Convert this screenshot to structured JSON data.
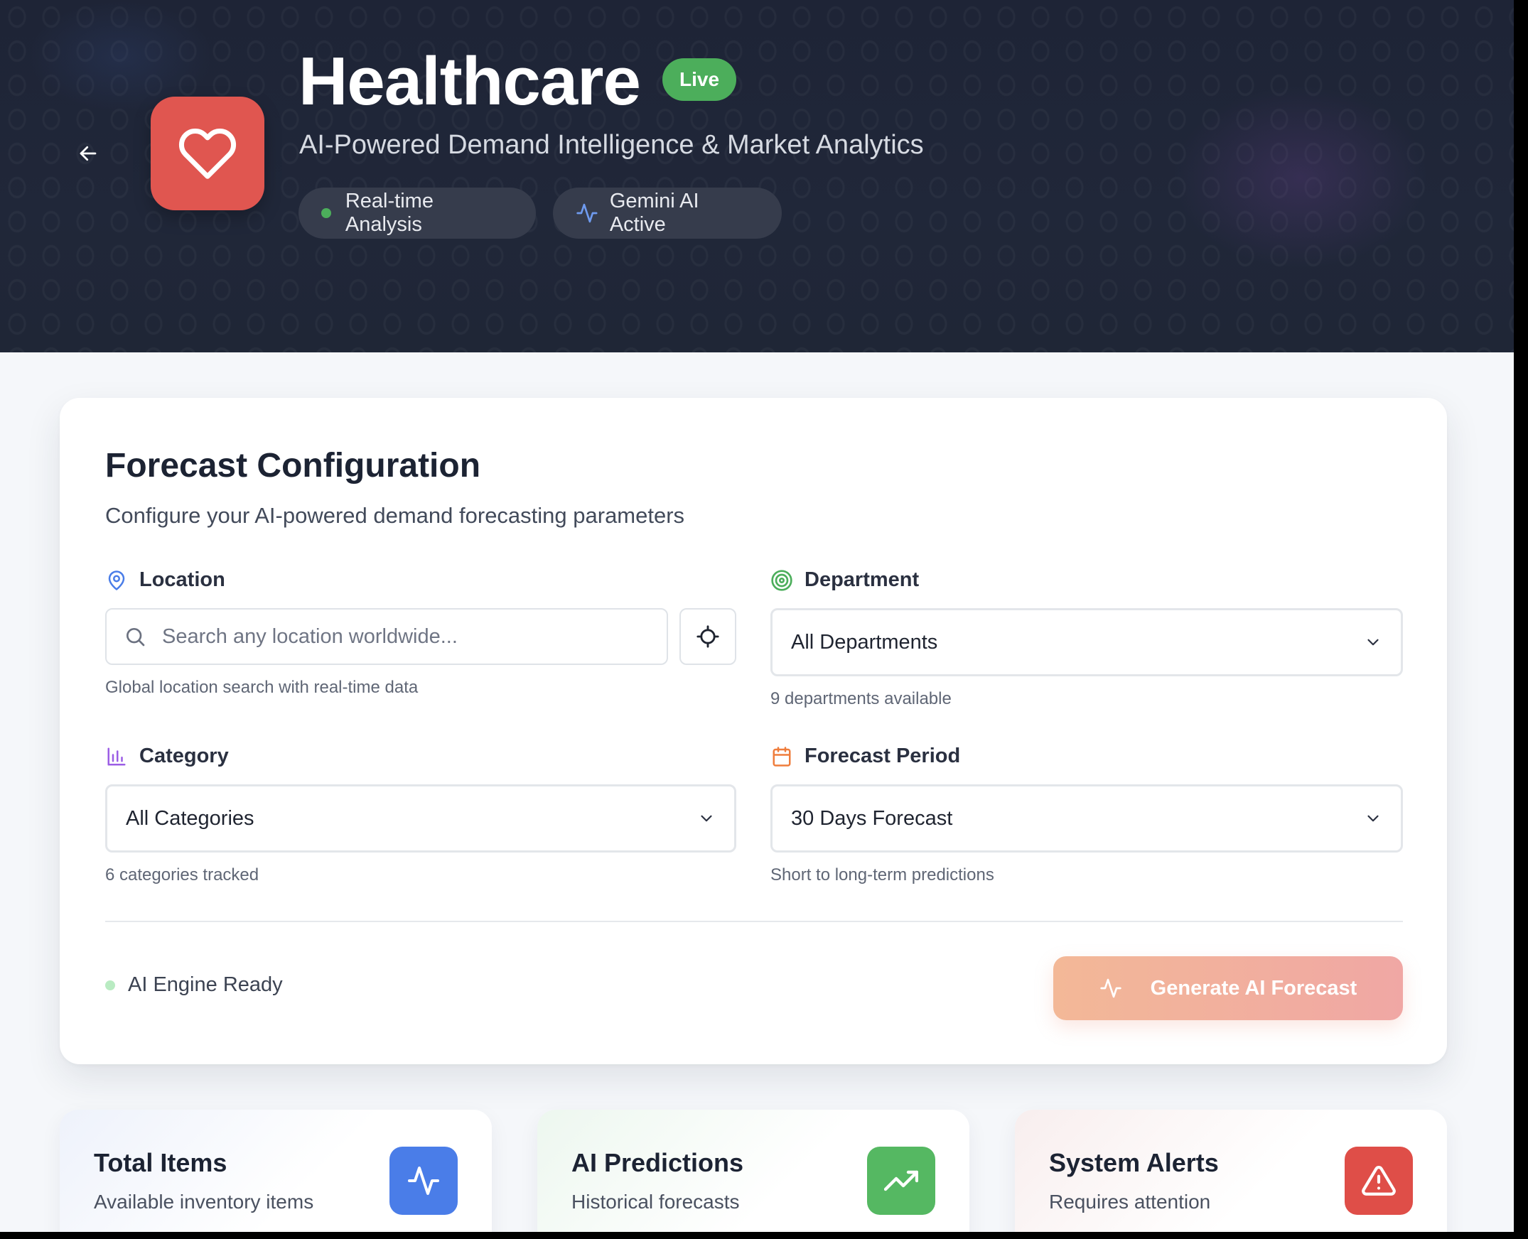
{
  "header": {
    "title": "Healthcare",
    "badge": "Live",
    "subtitle": "AI-Powered Demand Intelligence & Market Analytics",
    "pills": [
      {
        "label": "Real-time Analysis",
        "icon": "status-dot"
      },
      {
        "label": "Gemini AI Active",
        "icon": "activity-icon"
      }
    ],
    "logo_icon": "heart-icon",
    "logo_color": "#e05650"
  },
  "config": {
    "title": "Forecast Configuration",
    "subtitle": "Configure your AI-powered demand forecasting parameters",
    "location": {
      "label": "Location",
      "placeholder": "Search any location worldwide...",
      "value": "",
      "helper": "Global location search with real-time data"
    },
    "department": {
      "label": "Department",
      "selected": "All Departments",
      "helper": "9 departments available"
    },
    "category": {
      "label": "Category",
      "selected": "All Categories",
      "helper": "6 categories tracked"
    },
    "period": {
      "label": "Forecast Period",
      "selected": "30 Days Forecast",
      "helper": "Short to long-term predictions"
    },
    "status": "AI Engine Ready",
    "generate_label": "Generate AI Forecast"
  },
  "stats": [
    {
      "title": "Total Items",
      "subtitle": "Available inventory items",
      "icon": "activity-icon",
      "color": "#4a7de8"
    },
    {
      "title": "AI Predictions",
      "subtitle": "Historical forecasts",
      "icon": "trending-up-icon",
      "color": "#55b862"
    },
    {
      "title": "System Alerts",
      "subtitle": "Requires attention",
      "icon": "alert-triangle-icon",
      "color": "#df4e48"
    }
  ]
}
